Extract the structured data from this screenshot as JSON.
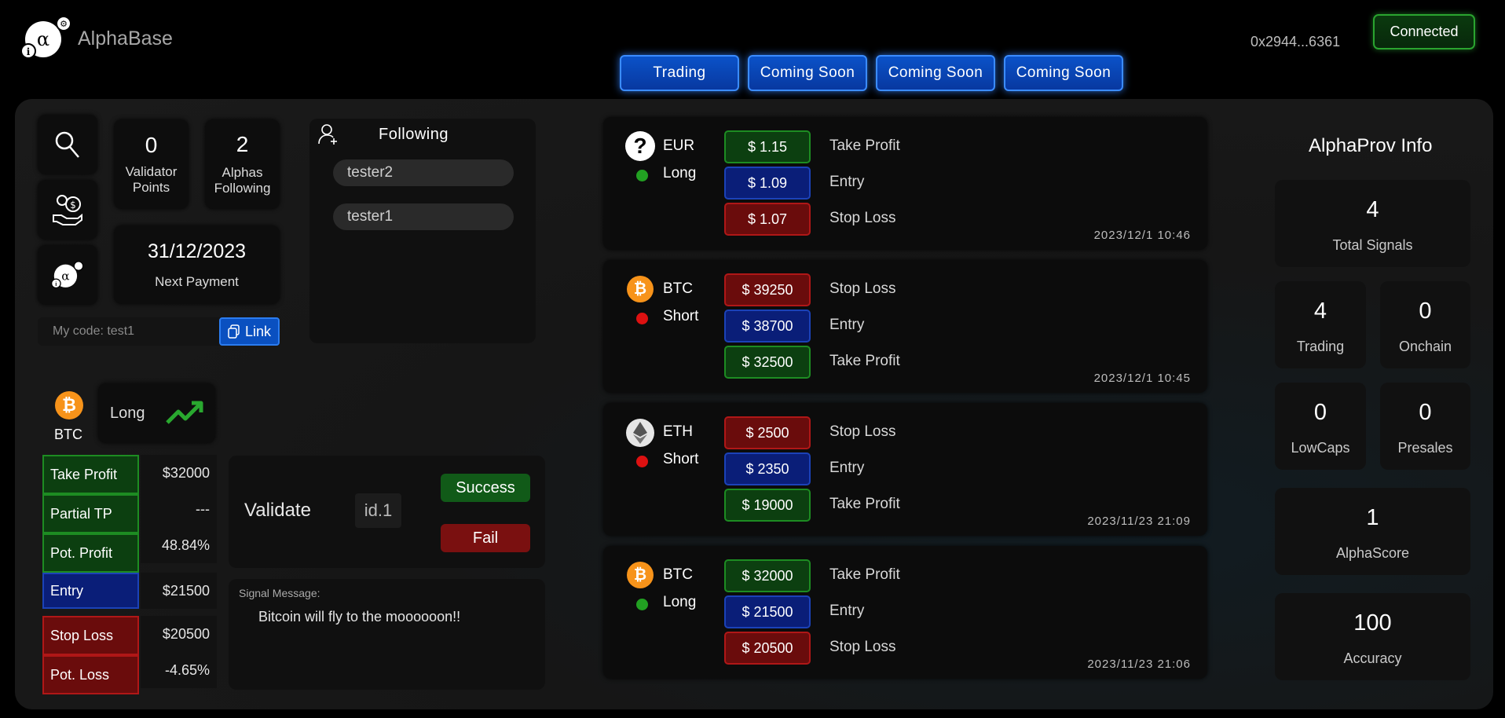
{
  "header": {
    "app_name": "AlphaBase",
    "wallet": "0x2944...6361",
    "connected_label": "Connected",
    "nav": [
      "Trading",
      "Coming Soon",
      "Coming Soon",
      "Coming Soon"
    ]
  },
  "stats": {
    "validator_points": "0",
    "validator_points_label_1": "Validator",
    "validator_points_label_2": "Points",
    "alphas_following": "2",
    "alphas_following_label_1": "Alphas",
    "alphas_following_label_2": "Following",
    "next_payment_date": "31/12/2023",
    "next_payment_label": "Next Payment"
  },
  "referral": {
    "placeholder": "My code: test1",
    "link_label": "Link"
  },
  "following": {
    "title": "Following",
    "users": [
      "tester2",
      "tester1"
    ]
  },
  "signal_detail": {
    "coin": "BTC",
    "direction": "Long",
    "rows_profit": [
      {
        "label": "Take Profit",
        "value": "$32000"
      },
      {
        "label": "Partial TP",
        "value": "---"
      },
      {
        "label": "Pot. Profit",
        "value": "48.84%"
      }
    ],
    "entry": {
      "label": "Entry",
      "value": "$21500"
    },
    "rows_loss": [
      {
        "label": "Stop Loss",
        "value": "$20500"
      },
      {
        "label": "Pot. Loss",
        "value": "-4.65%"
      }
    ]
  },
  "validate": {
    "title": "Validate",
    "id": "id.1",
    "success_label": "Success",
    "fail_label": "Fail",
    "message_label": "Signal Message:",
    "message": "Bitcoin will fly to the moooooon!!"
  },
  "signals": [
    {
      "coin": "EUR",
      "icon": "question-icon",
      "direction": "Long",
      "dir_color": "#22a022",
      "rows": [
        {
          "price": "$ 1.15",
          "label": "Take Profit",
          "color": "green"
        },
        {
          "price": "$ 1.09",
          "label": "Entry",
          "color": "blue"
        },
        {
          "price": "$ 1.07",
          "label": "Stop Loss",
          "color": "red"
        }
      ],
      "timestamp": "2023/12/1 10:46"
    },
    {
      "coin": "BTC",
      "icon": "bitcoin-icon",
      "direction": "Short",
      "dir_color": "#dd1111",
      "rows": [
        {
          "price": "$ 39250",
          "label": "Stop Loss",
          "color": "red"
        },
        {
          "price": "$ 38700",
          "label": "Entry",
          "color": "blue"
        },
        {
          "price": "$ 32500",
          "label": "Take Profit",
          "color": "green"
        }
      ],
      "timestamp": "2023/12/1 10:45"
    },
    {
      "coin": "ETH",
      "icon": "ethereum-icon",
      "direction": "Short",
      "dir_color": "#dd1111",
      "rows": [
        {
          "price": "$ 2500",
          "label": "Stop Loss",
          "color": "red"
        },
        {
          "price": "$ 2350",
          "label": "Entry",
          "color": "blue"
        },
        {
          "price": "$ 19000",
          "label": "Take Profit",
          "color": "green"
        }
      ],
      "timestamp": "2023/11/23 21:09"
    },
    {
      "coin": "BTC",
      "icon": "bitcoin-icon",
      "direction": "Long",
      "dir_color": "#22a022",
      "rows": [
        {
          "price": "$ 32000",
          "label": "Take Profit",
          "color": "green"
        },
        {
          "price": "$ 21500",
          "label": "Entry",
          "color": "blue"
        },
        {
          "price": "$ 20500",
          "label": "Stop Loss",
          "color": "red"
        }
      ],
      "timestamp": "2023/11/23 21:06"
    }
  ],
  "info": {
    "title": "AlphaProv Info",
    "total_signals": {
      "value": "4",
      "label": "Total Signals"
    },
    "trading": {
      "value": "4",
      "label": "Trading"
    },
    "onchain": {
      "value": "0",
      "label": "Onchain"
    },
    "lowcaps": {
      "value": "0",
      "label": "LowCaps"
    },
    "presales": {
      "value": "0",
      "label": "Presales"
    },
    "alphascore": {
      "value": "1",
      "label": "AlphaScore"
    },
    "accuracy": {
      "value": "100",
      "label": "Accuracy"
    }
  }
}
